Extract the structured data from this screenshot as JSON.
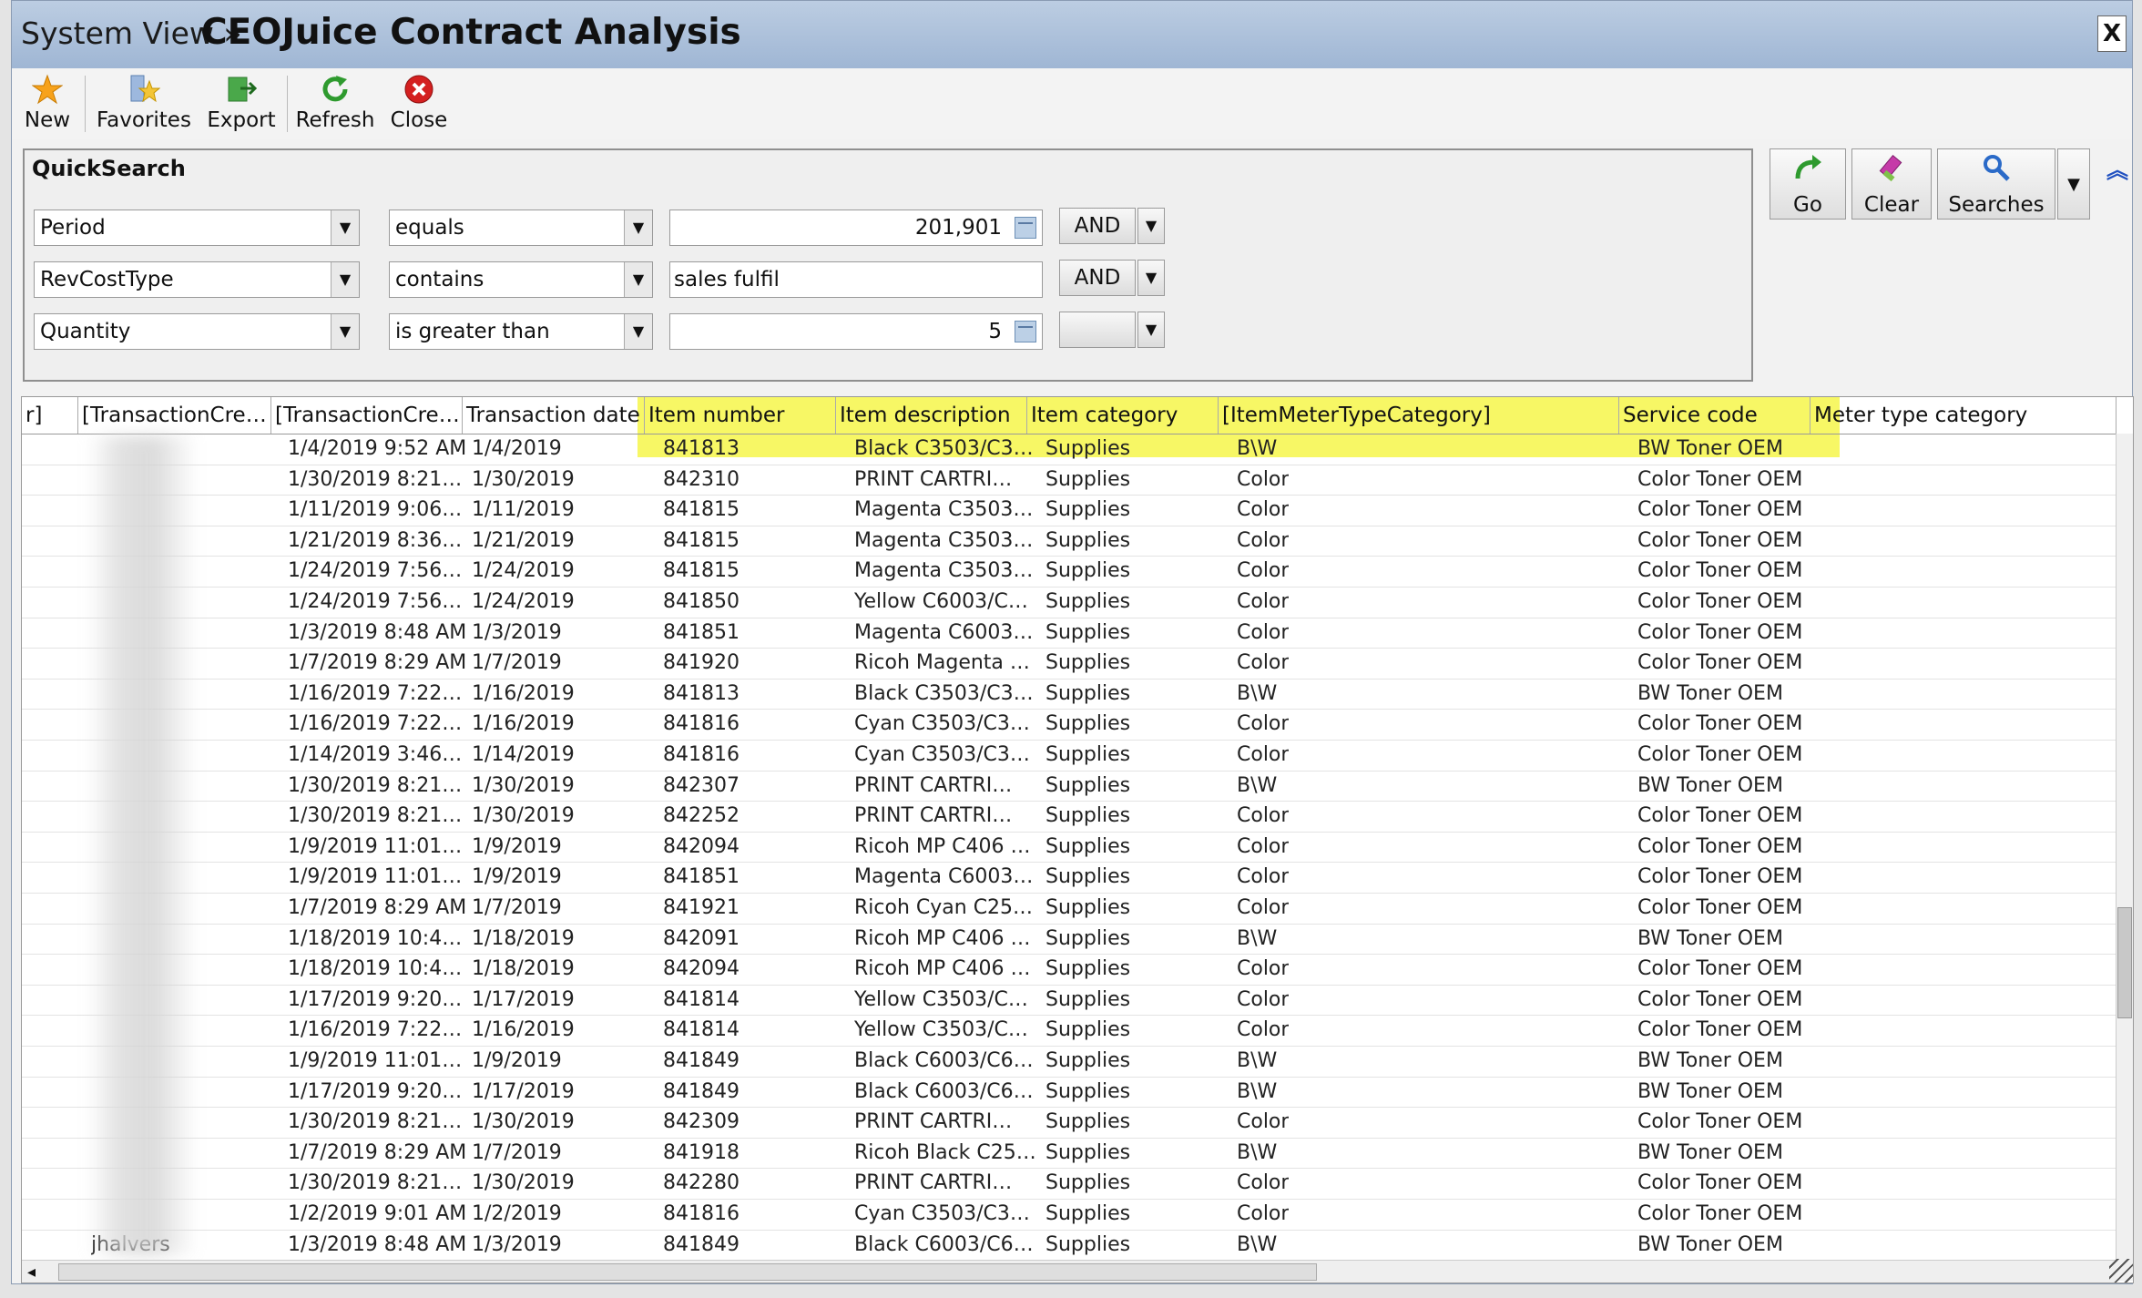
{
  "title": {
    "prefix": "System View »",
    "main": "CEOJuice Contract Analysis",
    "close": "X"
  },
  "toolbar": {
    "new": "New",
    "favorites": "Favorites",
    "export": "Export",
    "refresh": "Refresh",
    "close": "Close"
  },
  "quicksearch": {
    "title": "QuickSearch",
    "rows": [
      {
        "field": "Period",
        "operator": "equals",
        "value": "201,901",
        "connector": "AND"
      },
      {
        "field": "RevCostType",
        "operator": "contains",
        "value": "sales fulfil",
        "connector": "AND"
      },
      {
        "field": "Quantity",
        "operator": "is greater than",
        "value": "5",
        "connector": ""
      }
    ],
    "go": "Go",
    "clear": "Clear",
    "searches": "Searches"
  },
  "grid": {
    "columns": [
      "r]",
      "[TransactionCre…",
      "[TransactionCre…",
      "Transaction date",
      "Item number",
      "Item description",
      "Item category",
      "[ItemMeterTypeCategory]",
      "Service code",
      "Meter type category"
    ],
    "last_row_user": "jhalvers",
    "rows": [
      [
        "1/4/2019 9:52 AM",
        "1/4/2019",
        "841813",
        "Black C3503/C3…",
        "Supplies",
        "B\\W",
        "BW Toner OEM"
      ],
      [
        "1/30/2019 8:21…",
        "1/30/2019",
        "842310",
        "PRINT CARTRI…",
        "Supplies",
        "Color",
        "Color Toner OEM"
      ],
      [
        "1/11/2019 9:06…",
        "1/11/2019",
        "841815",
        "Magenta C3503…",
        "Supplies",
        "Color",
        "Color Toner OEM"
      ],
      [
        "1/21/2019 8:36…",
        "1/21/2019",
        "841815",
        "Magenta C3503…",
        "Supplies",
        "Color",
        "Color Toner OEM"
      ],
      [
        "1/24/2019 7:56…",
        "1/24/2019",
        "841815",
        "Magenta C3503…",
        "Supplies",
        "Color",
        "Color Toner OEM"
      ],
      [
        "1/24/2019 7:56…",
        "1/24/2019",
        "841850",
        "Yellow C6003/C…",
        "Supplies",
        "Color",
        "Color Toner OEM"
      ],
      [
        "1/3/2019 8:48 AM",
        "1/3/2019",
        "841851",
        "Magenta C6003…",
        "Supplies",
        "Color",
        "Color Toner OEM"
      ],
      [
        "1/7/2019 8:29 AM",
        "1/7/2019",
        "841920",
        "Ricoh Magenta …",
        "Supplies",
        "Color",
        "Color Toner OEM"
      ],
      [
        "1/16/2019 7:22…",
        "1/16/2019",
        "841813",
        "Black C3503/C3…",
        "Supplies",
        "B\\W",
        "BW Toner OEM"
      ],
      [
        "1/16/2019 7:22…",
        "1/16/2019",
        "841816",
        "Cyan C3503/C3…",
        "Supplies",
        "Color",
        "Color Toner OEM"
      ],
      [
        "1/14/2019 3:46…",
        "1/14/2019",
        "841816",
        "Cyan C3503/C3…",
        "Supplies",
        "Color",
        "Color Toner OEM"
      ],
      [
        "1/30/2019 8:21…",
        "1/30/2019",
        "842307",
        "PRINT CARTRI…",
        "Supplies",
        "B\\W",
        "BW Toner OEM"
      ],
      [
        "1/30/2019 8:21…",
        "1/30/2019",
        "842252",
        "PRINT CARTRI…",
        "Supplies",
        "Color",
        "Color Toner OEM"
      ],
      [
        "1/9/2019 11:01…",
        "1/9/2019",
        "842094",
        "Ricoh MP C406 …",
        "Supplies",
        "Color",
        "Color Toner OEM"
      ],
      [
        "1/9/2019 11:01…",
        "1/9/2019",
        "841851",
        "Magenta C6003…",
        "Supplies",
        "Color",
        "Color Toner OEM"
      ],
      [
        "1/7/2019 8:29 AM",
        "1/7/2019",
        "841921",
        "Ricoh Cyan C25…",
        "Supplies",
        "Color",
        "Color Toner OEM"
      ],
      [
        "1/18/2019 10:4…",
        "1/18/2019",
        "842091",
        "Ricoh MP C406 …",
        "Supplies",
        "B\\W",
        "BW Toner OEM"
      ],
      [
        "1/18/2019 10:4…",
        "1/18/2019",
        "842094",
        "Ricoh MP C406 …",
        "Supplies",
        "Color",
        "Color Toner OEM"
      ],
      [
        "1/17/2019 9:20…",
        "1/17/2019",
        "841814",
        "Yellow C3503/C…",
        "Supplies",
        "Color",
        "Color Toner OEM"
      ],
      [
        "1/16/2019 7:22…",
        "1/16/2019",
        "841814",
        "Yellow C3503/C…",
        "Supplies",
        "Color",
        "Color Toner OEM"
      ],
      [
        "1/9/2019 11:01…",
        "1/9/2019",
        "841849",
        "Black C6003/C6…",
        "Supplies",
        "B\\W",
        "BW Toner OEM"
      ],
      [
        "1/17/2019 9:20…",
        "1/17/2019",
        "841849",
        "Black C6003/C6…",
        "Supplies",
        "B\\W",
        "BW Toner OEM"
      ],
      [
        "1/30/2019 8:21…",
        "1/30/2019",
        "842309",
        "PRINT CARTRI…",
        "Supplies",
        "Color",
        "Color Toner OEM"
      ],
      [
        "1/7/2019 8:29 AM",
        "1/7/2019",
        "841918",
        "Ricoh Black C25…",
        "Supplies",
        "B\\W",
        "BW Toner OEM"
      ],
      [
        "1/30/2019 8:21…",
        "1/30/2019",
        "842280",
        "PRINT CARTRI…",
        "Supplies",
        "Color",
        "Color Toner OEM"
      ],
      [
        "1/2/2019 9:01 AM",
        "1/2/2019",
        "841816",
        "Cyan C3503/C3…",
        "Supplies",
        "Color",
        "Color Toner OEM"
      ],
      [
        "1/3/2019 8:48 AM",
        "1/3/2019",
        "841849",
        "Black C6003/C6…",
        "Supplies",
        "B\\W",
        "BW Toner OEM"
      ]
    ]
  }
}
